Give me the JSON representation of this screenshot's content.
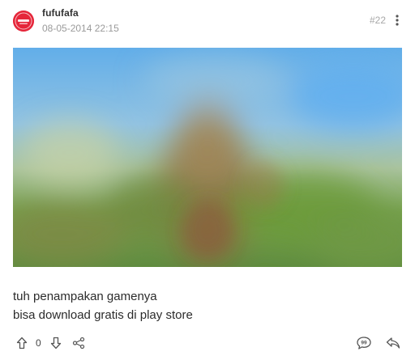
{
  "post": {
    "username": "fufufafa",
    "timestamp": "08-05-2014 22:15",
    "number": "#22",
    "avatar_color": "#e5263a",
    "image_alt": "blurred game screenshot",
    "text_lines": [
      "tuh penampakan gamenya",
      "bisa download gratis di play store"
    ],
    "vote_count": "0"
  },
  "icons": {
    "more": "more-vertical-icon",
    "upvote": "arrow-up-icon",
    "downvote": "arrow-down-icon",
    "share": "share-icon",
    "quote": "quote-icon",
    "reply": "reply-icon"
  }
}
